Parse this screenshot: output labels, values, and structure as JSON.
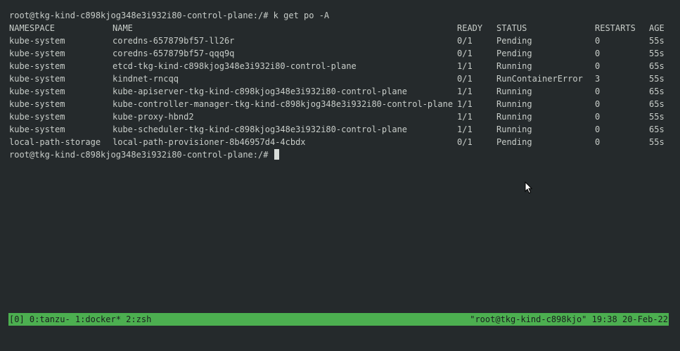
{
  "terminal": {
    "command_line": "root@tkg-kind-c898kjog348e3i932i80-control-plane:/# k get po -A",
    "prompt": "root@tkg-kind-c898kjog348e3i932i80-control-plane:/# ",
    "headers": {
      "namespace": "NAMESPACE",
      "name": "NAME",
      "ready": "READY",
      "status": "STATUS",
      "restarts": "RESTARTS",
      "age": "AGE"
    },
    "rows": [
      {
        "namespace": "kube-system",
        "name": "coredns-657879bf57-ll26r",
        "ready": "0/1",
        "status": "Pending",
        "restarts": "0",
        "age": "55s"
      },
      {
        "namespace": "kube-system",
        "name": "coredns-657879bf57-qqq9q",
        "ready": "0/1",
        "status": "Pending",
        "restarts": "0",
        "age": "55s"
      },
      {
        "namespace": "kube-system",
        "name": "etcd-tkg-kind-c898kjog348e3i932i80-control-plane",
        "ready": "1/1",
        "status": "Running",
        "restarts": "0",
        "age": "65s"
      },
      {
        "namespace": "kube-system",
        "name": "kindnet-rncqq",
        "ready": "0/1",
        "status": "RunContainerError",
        "restarts": "3",
        "age": "55s"
      },
      {
        "namespace": "kube-system",
        "name": "kube-apiserver-tkg-kind-c898kjog348e3i932i80-control-plane",
        "ready": "1/1",
        "status": "Running",
        "restarts": "0",
        "age": "65s"
      },
      {
        "namespace": "kube-system",
        "name": "kube-controller-manager-tkg-kind-c898kjog348e3i932i80-control-plane",
        "ready": "1/1",
        "status": "Running",
        "restarts": "0",
        "age": "65s"
      },
      {
        "namespace": "kube-system",
        "name": "kube-proxy-hbnd2",
        "ready": "1/1",
        "status": "Running",
        "restarts": "0",
        "age": "55s"
      },
      {
        "namespace": "kube-system",
        "name": "kube-scheduler-tkg-kind-c898kjog348e3i932i80-control-plane",
        "ready": "1/1",
        "status": "Running",
        "restarts": "0",
        "age": "65s"
      },
      {
        "namespace": "local-path-storage",
        "name": "local-path-provisioner-8b46957d4-4cbdx",
        "ready": "0/1",
        "status": "Pending",
        "restarts": "0",
        "age": "55s"
      }
    ]
  },
  "statusbar": {
    "left": "[0] 0:tanzu- 1:docker* 2:zsh",
    "right": "\"root@tkg-kind-c898kjo\" 19:38 20-Feb-22"
  },
  "colors": {
    "background": "#252a2c",
    "foreground": "#c8cdc9",
    "statusbar_bg": "#4caf50",
    "statusbar_fg": "#1a1d1e"
  },
  "icons": {
    "mouse_pointer": "mouse-pointer-icon"
  }
}
